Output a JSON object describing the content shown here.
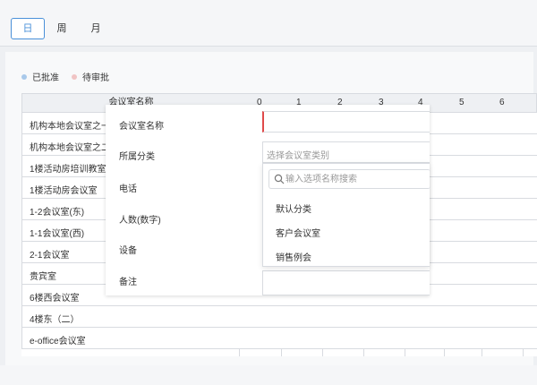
{
  "view_tabs": [
    {
      "label": "日",
      "active": true
    },
    {
      "label": "周",
      "active": false
    },
    {
      "label": "月",
      "active": false
    }
  ],
  "legend": [
    {
      "label": "已批准",
      "color": "#a9c9ea"
    },
    {
      "label": "待审批",
      "color": "#f0c4c4"
    }
  ],
  "grid": {
    "name_header": "会议室名称",
    "hours": [
      "0",
      "1",
      "2",
      "3",
      "4",
      "5",
      "6"
    ],
    "rooms": [
      "机构本地会议室之一",
      "机构本地会议室之二",
      "1楼活动房培训教室",
      "1楼活动房会议室",
      "1-2会议室(东)",
      "1-1会议室(西)",
      "2-1会议室",
      "贵宾室",
      "6楼西会议室",
      "4楼东（二）",
      "e-office会议室"
    ]
  },
  "form": {
    "labels": {
      "name": "会议室名称",
      "category": "所属分类",
      "phone": "电话",
      "capacity": "人数(数字)",
      "equipment": "设备",
      "note": "备注"
    },
    "category_placeholder": "选择会议室类别"
  },
  "dropdown": {
    "search_placeholder": "输入选项名称搜索",
    "options": [
      "默认分类",
      "客户会议室",
      "销售例会"
    ]
  },
  "colors": {
    "accent": "#4a90d9",
    "required_marker": "#e04a4a"
  }
}
